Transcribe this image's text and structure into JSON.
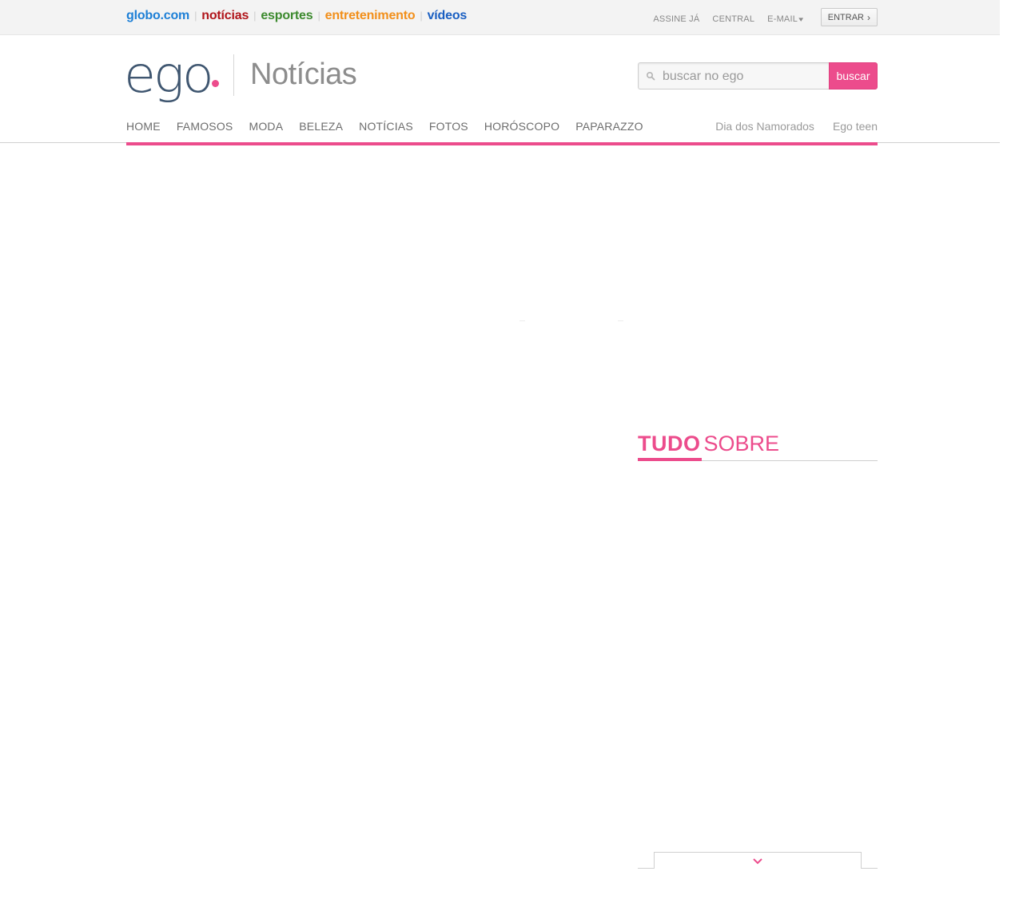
{
  "topbar": {
    "links": [
      {
        "label": "globo.com",
        "color": "#1d7fd6"
      },
      {
        "label": "notícias",
        "color": "#b0141a"
      },
      {
        "label": "esportes",
        "color": "#3c8a2e"
      },
      {
        "label": "entretenimento",
        "color": "#f28f1a"
      },
      {
        "label": "vídeos",
        "color": "#1a5fc2"
      }
    ],
    "assine": "ASSINE JÁ",
    "central": "CENTRAL",
    "email": "E-MAIL",
    "entrar": "ENTRAR"
  },
  "header": {
    "logo": "ego",
    "section": "Notícias",
    "search_placeholder": "buscar no ego",
    "search_button": "buscar"
  },
  "nav": {
    "items": [
      "HOME",
      "FAMOSOS",
      "MODA",
      "BELEZA",
      "NOTÍCIAS",
      "FOTOS",
      "HORÓSCOPO",
      "PAPARAZZO"
    ],
    "right": [
      "Dia dos Namorados",
      "Ego teen"
    ]
  },
  "sidebar": {
    "tudo": "TUDO",
    "sobre": "SOBRE"
  },
  "colors": {
    "accent": "#ec4c8c",
    "logo": "#3f5670"
  }
}
